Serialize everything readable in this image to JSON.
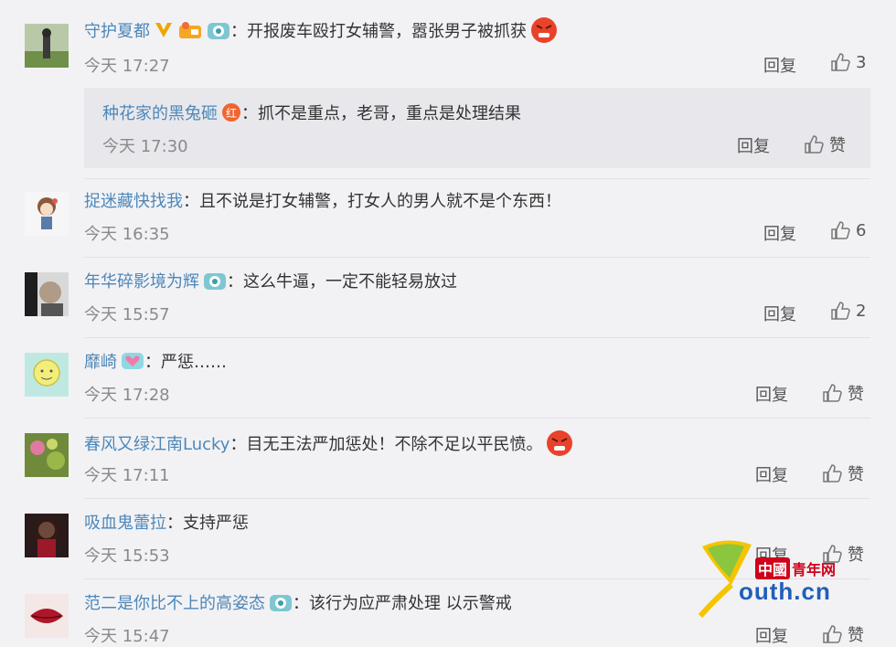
{
  "comments": [
    {
      "user": "守护夏都",
      "text": "：开报废车殴打女辅警，嚣张男子被抓获",
      "time": "今天 17:27",
      "reply_label": "回复",
      "like_label": "3",
      "reply": {
        "user": "种花家的黑兔砸",
        "text": "：抓不是重点，老哥，重点是处理结果",
        "time": "今天 17:30",
        "reply_label": "回复",
        "like_label": "赞"
      }
    },
    {
      "user": "捉迷藏快找我",
      "text": "：且不说是打女辅警，打女人的男人就不是个东西！",
      "time": "今天 16:35",
      "reply_label": "回复",
      "like_label": "6"
    },
    {
      "user": "年华碎影境为辉",
      "text": "：这么牛逼，一定不能轻易放过",
      "time": "今天 15:57",
      "reply_label": "回复",
      "like_label": "2"
    },
    {
      "user": "靡崎",
      "text": "：严惩……",
      "time": "今天 17:28",
      "reply_label": "回复",
      "like_label": "赞"
    },
    {
      "user": "春风又绿江南Lucky",
      "text": "：目无王法严加惩处！不除不足以平民愤。",
      "time": "今天 17:11",
      "reply_label": "回复",
      "like_label": "赞"
    },
    {
      "user": "吸血鬼蕾拉",
      "text": "：支持严惩",
      "time": "今天 15:53",
      "reply_label": "回复",
      "like_label": "赞"
    },
    {
      "user": "范二是你比不上的高姿态",
      "text": "：该行为应严肃处理 以示警戒",
      "time": "今天 15:47",
      "reply_label": "回复",
      "like_label": "赞"
    }
  ],
  "watermark": {
    "brand_cn": "中國",
    "brand_cn2": "青年网",
    "brand_en": "outh.cn"
  },
  "colors": {
    "username": "#4d87b8",
    "background": "#f2f2f5",
    "reply_box": "#e8e8ec"
  }
}
